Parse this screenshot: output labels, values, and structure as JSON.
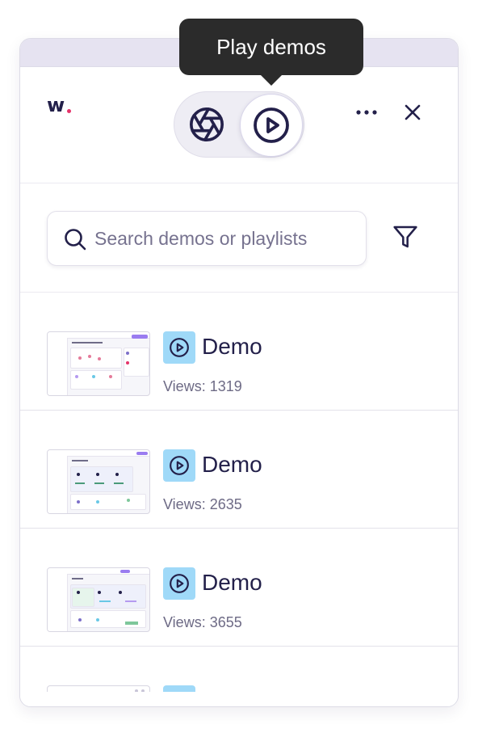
{
  "tooltip": {
    "text": "Play demos"
  },
  "header": {
    "logo_text": "w",
    "toggle": {
      "left_icon": "aperture-icon",
      "right_icon": "play-circle-icon",
      "selected": "play"
    },
    "more_icon": "more-horizontal-icon",
    "close_icon": "close-icon"
  },
  "search": {
    "placeholder": "Search demos or playlists",
    "value": "",
    "filter_icon": "filter-icon"
  },
  "demos": [
    {
      "title": "Demo",
      "views": "Views: 1319",
      "thumb_label": "Market Data Academy"
    },
    {
      "title": "Demo",
      "views": "Views: 2635",
      "thumb_label": "Trades"
    },
    {
      "title": "Demo",
      "views": "Views: 3655",
      "thumb_label": "Trades"
    }
  ],
  "colors": {
    "accent": "#9a7cf0",
    "badge": "#9fd9f8",
    "text_primary": "#23204a",
    "text_secondary": "#6d6a85"
  }
}
